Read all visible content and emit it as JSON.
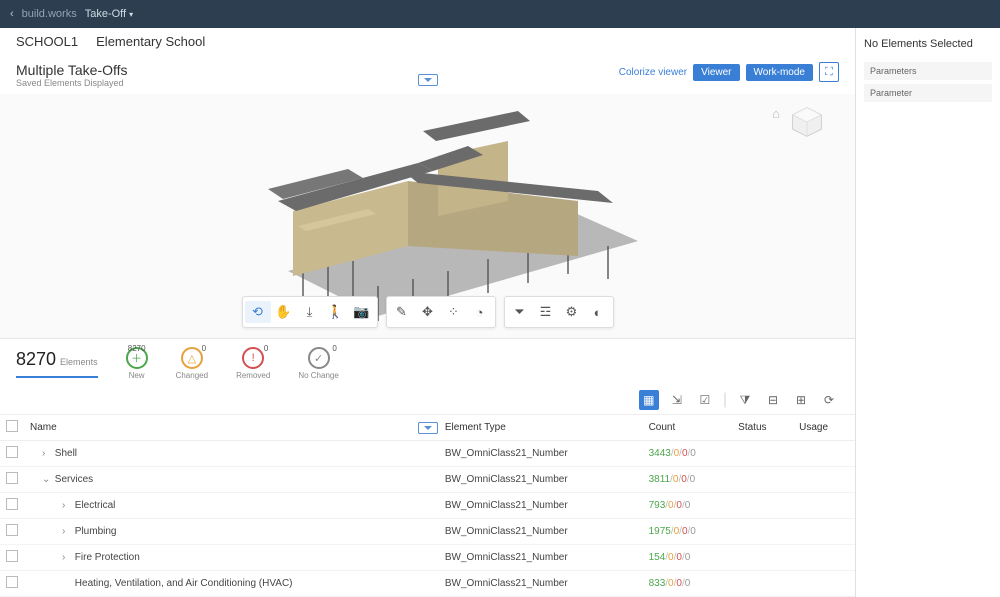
{
  "topnav": {
    "brand": "build.works",
    "menu": "Take-Off"
  },
  "breadcrumb": {
    "code": "SCHOOL1",
    "name": "Elementary School"
  },
  "header": {
    "title": "Multiple Take-Offs",
    "subtitle": "Saved Elements Displayed",
    "colorize": "Colorize viewer",
    "viewer": "Viewer",
    "workmode": "Work-mode"
  },
  "stats": {
    "total": "8270",
    "total_label": "Elements",
    "new_badge": "8270",
    "new_label": "New",
    "changed_badge": "0",
    "changed_label": "Changed",
    "removed_badge": "0",
    "removed_label": "Removed",
    "nochange_badge": "0",
    "nochange_label": "No Change"
  },
  "table": {
    "headers": [
      "Name",
      "Element Type",
      "Count",
      "Status",
      "Usage"
    ],
    "rows": [
      {
        "indent": 1,
        "expand": ">",
        "name": "Shell",
        "etype": "BW_OmniClass21_Number",
        "count": [
          "3443",
          "0",
          "0",
          "0"
        ]
      },
      {
        "indent": 1,
        "expand": "v",
        "name": "Services",
        "etype": "BW_OmniClass21_Number",
        "count": [
          "3811",
          "0",
          "0",
          "0"
        ]
      },
      {
        "indent": 2,
        "expand": ">",
        "name": "Electrical",
        "etype": "BW_OmniClass21_Number",
        "count": [
          "793",
          "0",
          "0",
          "0"
        ]
      },
      {
        "indent": 2,
        "expand": ">",
        "name": "Plumbing",
        "etype": "BW_OmniClass21_Number",
        "count": [
          "1975",
          "0",
          "0",
          "0"
        ]
      },
      {
        "indent": 2,
        "expand": ">",
        "name": "Fire Protection",
        "etype": "BW_OmniClass21_Number",
        "count": [
          "154",
          "0",
          "0",
          "0"
        ]
      },
      {
        "indent": 2,
        "expand": "",
        "name": "Heating, Ventilation, and Air Conditioning (HVAC)",
        "etype": "BW_OmniClass21_Number",
        "count": [
          "833",
          "0",
          "0",
          "0"
        ]
      }
    ]
  },
  "rightpanel": {
    "title": "No Elements Selected",
    "section1": "Parameters",
    "section2": "Parameter"
  }
}
